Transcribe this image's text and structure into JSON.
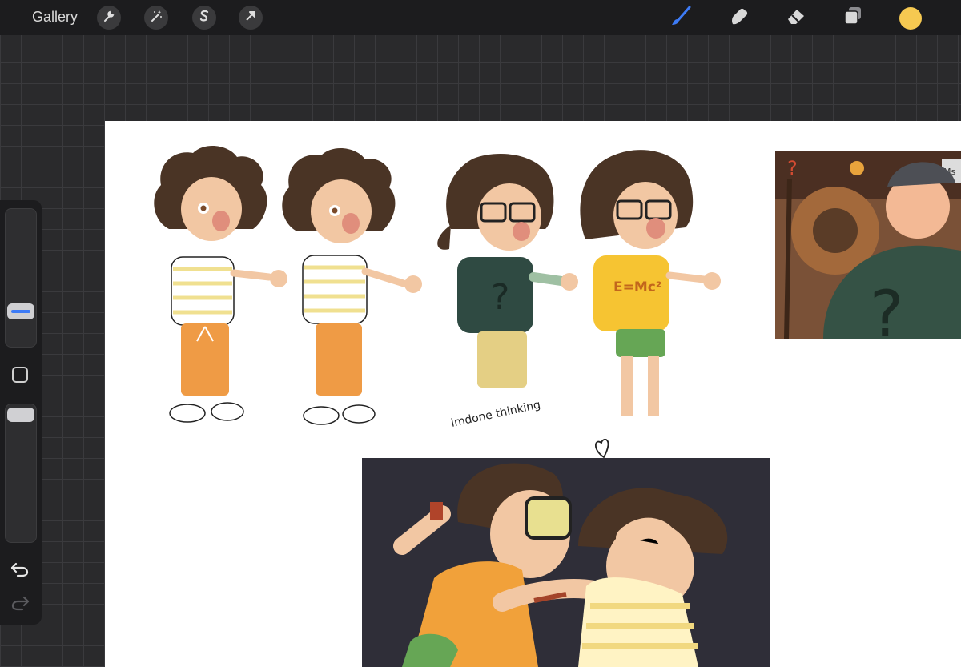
{
  "toolbar": {
    "gallery_label": "Gallery",
    "left_tools": [
      "wrench-icon",
      "magic-wand-icon",
      "selection-s-icon",
      "arrow-cursor-icon"
    ],
    "right_tools": [
      "brush-icon",
      "smudge-icon",
      "eraser-icon",
      "layers-icon"
    ],
    "active_tool": "brush-icon",
    "accent_color": "#3d7bf6",
    "current_color": "#f6c951"
  },
  "sidebar": {
    "controls": [
      "brush-size-slider",
      "modify-button",
      "opacity-slider",
      "undo-icon",
      "redo-icon"
    ]
  },
  "canvas": {
    "background": "#ffffff",
    "sketch_note": "imdone thinking :|",
    "shirt_text": "E=Mc²",
    "sign_text": "Ms"
  }
}
